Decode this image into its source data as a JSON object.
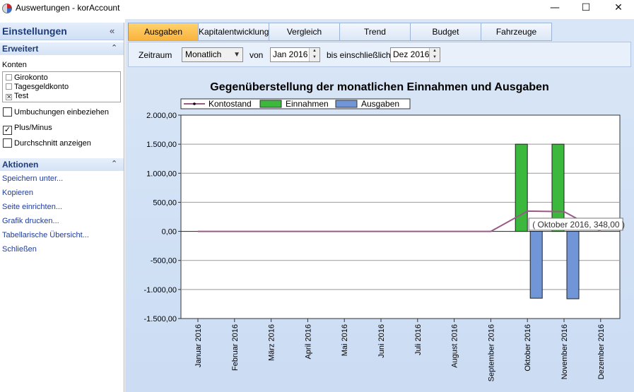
{
  "window": {
    "title": "Auswertungen - korAccount",
    "minimize": "—",
    "maximize": "☐",
    "close": "✕"
  },
  "sidebar": {
    "title": "Einstellungen",
    "collapse_icon": "«",
    "sections": {
      "advanced": {
        "title": "Erweitert",
        "arrow": "⌃"
      },
      "actions": {
        "title": "Aktionen",
        "arrow": "⌃"
      }
    },
    "accounts_label": "Konten",
    "accounts": [
      {
        "label": "Girokonto",
        "checked": false
      },
      {
        "label": "Tagesgeldkonto",
        "checked": false
      },
      {
        "label": "Test",
        "checked": true
      }
    ],
    "options": [
      {
        "label": "Umbuchungen einbeziehen",
        "checked": false
      },
      {
        "label": "Plus/Minus",
        "checked": true
      },
      {
        "label": "Durchschnitt anzeigen",
        "checked": false
      }
    ],
    "actions": [
      "Speichern unter...",
      "Kopieren",
      "Seite einrichten...",
      "Grafik drucken...",
      "Tabellarische Übersicht...",
      "Schließen"
    ]
  },
  "tabs": [
    "Ausgaben",
    "Kapitalentwicklung",
    "Vergleich",
    "Trend",
    "Budget",
    "Fahrzeuge"
  ],
  "active_tab": "Ausgaben",
  "filter": {
    "period_label": "Zeitraum",
    "period_value": "Monatlich",
    "from_label": "von",
    "from_value": "Jan 2016",
    "to_label": "bis einschließlich",
    "to_value": "Dez 2016"
  },
  "colors": {
    "accent_tab": "#f9b33e",
    "kontostand": "#9a5a86",
    "einnahmen": "#3cb83c",
    "ausgaben": "#7096d8"
  },
  "chart_data": {
    "type": "bar",
    "title": "Gegenüberstellung der monatlichen Einnahmen und Ausgaben",
    "categories": [
      "Januar 2016",
      "Februar 2016",
      "März 2016",
      "April 2016",
      "Mai 2016",
      "Juni 2016",
      "Juli 2016",
      "August 2016",
      "September 2016",
      "Oktober 2016",
      "November 2016",
      "Dezember 2016"
    ],
    "series": [
      {
        "name": "Kontostand",
        "kind": "line",
        "values": [
          0,
          0,
          0,
          0,
          0,
          0,
          0,
          0,
          0,
          348,
          340,
          0
        ]
      },
      {
        "name": "Einnahmen",
        "kind": "bar",
        "values": [
          0,
          0,
          0,
          0,
          0,
          0,
          0,
          0,
          0,
          1500,
          1500,
          0
        ]
      },
      {
        "name": "Ausgaben",
        "kind": "bar",
        "values": [
          0,
          0,
          0,
          0,
          0,
          0,
          0,
          0,
          0,
          -1150,
          -1160,
          0
        ]
      }
    ],
    "yticks": [
      "2.000,00",
      "1.500,00",
      "1.000,00",
      "500,00",
      "0,00",
      "-500,00",
      "-1.000,00",
      "-1.500,00"
    ],
    "ylim": [
      -1500,
      2000
    ],
    "grid": true,
    "legend_position": "top",
    "tooltip": "( Oktober 2016, 348,00 )"
  }
}
